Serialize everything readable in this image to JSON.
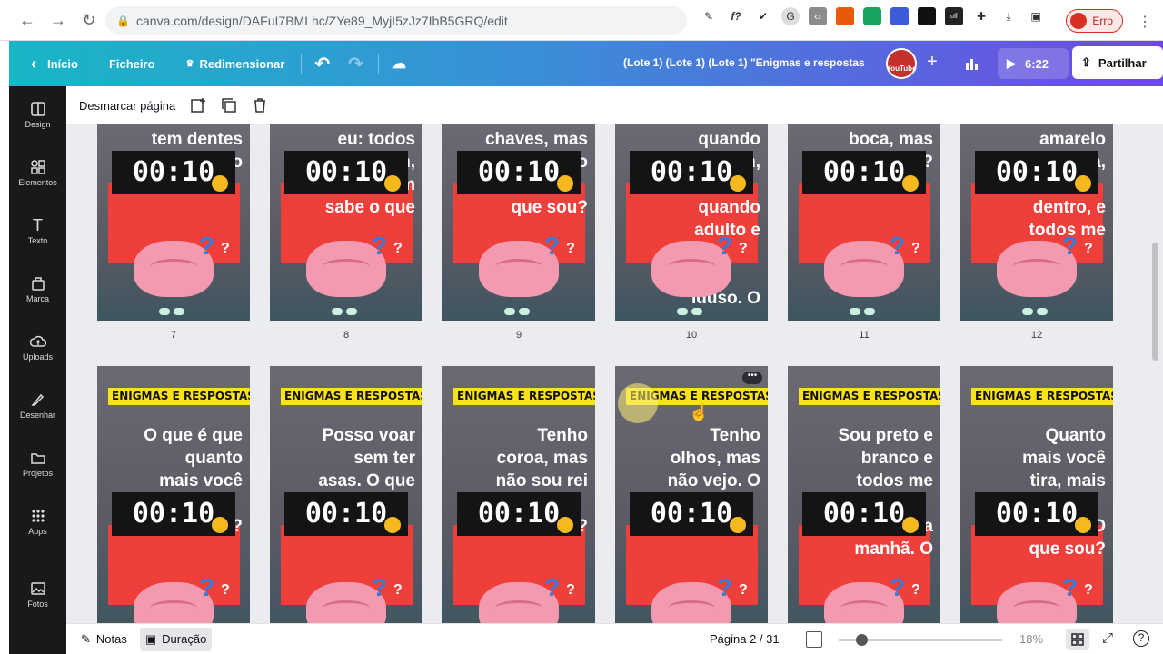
{
  "browser": {
    "url": "canva.com/design/DAFuI7BMLhc/ZYe89_MyjI5zJz7IbB5GRQ/edit",
    "profile_label": "Erro"
  },
  "topbar": {
    "home": "Início",
    "file": "Ficheiro",
    "resize": "Redimensionar",
    "doc_title": "(Lote 1) (Lote 1) (Lote 1) \"Enigmas e respostas",
    "duration": "6:22",
    "share": "Partilhar"
  },
  "rail": {
    "items": [
      "Design",
      "Elementos",
      "Texto",
      "Marca",
      "Uploads",
      "Desenhar",
      "Projetos",
      "Apps",
      "Fotos"
    ]
  },
  "pagebar": {
    "deselect": "Desmarcar página"
  },
  "pages_row1": [
    {
      "number": "7",
      "question": "tem dentes\ne não",
      "timer": "00:10"
    },
    {
      "number": "8",
      "question": "eu: todos\nme usam,\nninguém\nsabe o que",
      "timer": "00:10"
    },
    {
      "number": "9",
      "question": "chaves, mas\nnão abro\n\nque sou?",
      "timer": "00:10"
    },
    {
      "number": "10",
      "question": "quando\njovem,\n\nquando\nadulto e\n\n\niduso. O",
      "timer": "00:10"
    },
    {
      "number": "11",
      "question": "boca, mas\nnão fala?",
      "timer": "00:10"
    },
    {
      "number": "12",
      "question": "amarelo\npor fora,\n\ndentro, e\ntodos me",
      "timer": "00:10"
    }
  ],
  "pages_row2": [
    {
      "tag": "ENIGMAS E RESPOSTAS",
      "question": "O que é que\nquanto\nmais você\n\ncresce?",
      "timer": "00:10"
    },
    {
      "tag": "ENIGMAS E RESPOSTAS",
      "question": "Posso voar\nsem ter\nasas. O que",
      "timer": "00:10"
    },
    {
      "tag": "ENIGMAS E RESPOSTAS",
      "question": "Tenho\ncoroa, mas\nnão sou rei\n\nO que sou?",
      "timer": "00:10"
    },
    {
      "tag": "ENIGMAS E RESPOSTAS",
      "question": "Tenho\nolhos, mas\nnão vejo. O",
      "timer": "00:10"
    },
    {
      "tag": "ENIGMAS E RESPOSTAS",
      "question": "Sou preto e\nbranco e\ntodos me\n\ncafé da\nmanhã. O",
      "timer": "00:10"
    },
    {
      "tag": "ENIGMAS E RESPOSTAS",
      "question": "Quanto\nmais você\ntira, mais\n\ncorro. O\nque sou?",
      "timer": "00:10"
    }
  ],
  "footer": {
    "notes": "Notas",
    "duration": "Duração",
    "page_info": "Página 2 / 31",
    "zoom": "18%"
  },
  "colors": {
    "canva_gradient_start": "#18b6c6",
    "canva_gradient_end": "#6f48e3",
    "tag_yellow": "#f7e21b",
    "red_box": "#ef3f3a"
  }
}
